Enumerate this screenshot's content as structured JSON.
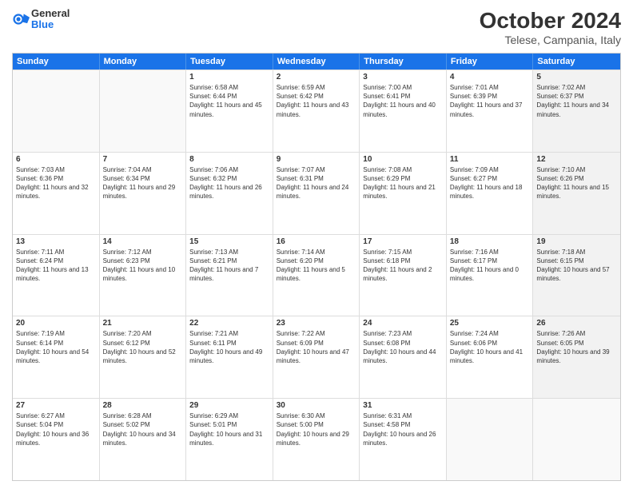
{
  "logo": {
    "line1": "General",
    "line2": "Blue"
  },
  "title": {
    "month": "October 2024",
    "location": "Telese, Campania, Italy"
  },
  "days": [
    "Sunday",
    "Monday",
    "Tuesday",
    "Wednesday",
    "Thursday",
    "Friday",
    "Saturday"
  ],
  "weeks": [
    [
      {
        "day": "",
        "text": "",
        "empty": true
      },
      {
        "day": "",
        "text": "",
        "empty": true
      },
      {
        "day": "1",
        "text": "Sunrise: 6:58 AM\nSunset: 6:44 PM\nDaylight: 11 hours and 45 minutes.",
        "shaded": false
      },
      {
        "day": "2",
        "text": "Sunrise: 6:59 AM\nSunset: 6:42 PM\nDaylight: 11 hours and 43 minutes.",
        "shaded": false
      },
      {
        "day": "3",
        "text": "Sunrise: 7:00 AM\nSunset: 6:41 PM\nDaylight: 11 hours and 40 minutes.",
        "shaded": false
      },
      {
        "day": "4",
        "text": "Sunrise: 7:01 AM\nSunset: 6:39 PM\nDaylight: 11 hours and 37 minutes.",
        "shaded": false
      },
      {
        "day": "5",
        "text": "Sunrise: 7:02 AM\nSunset: 6:37 PM\nDaylight: 11 hours and 34 minutes.",
        "shaded": true
      }
    ],
    [
      {
        "day": "6",
        "text": "Sunrise: 7:03 AM\nSunset: 6:36 PM\nDaylight: 11 hours and 32 minutes.",
        "shaded": false
      },
      {
        "day": "7",
        "text": "Sunrise: 7:04 AM\nSunset: 6:34 PM\nDaylight: 11 hours and 29 minutes.",
        "shaded": false
      },
      {
        "day": "8",
        "text": "Sunrise: 7:06 AM\nSunset: 6:32 PM\nDaylight: 11 hours and 26 minutes.",
        "shaded": false
      },
      {
        "day": "9",
        "text": "Sunrise: 7:07 AM\nSunset: 6:31 PM\nDaylight: 11 hours and 24 minutes.",
        "shaded": false
      },
      {
        "day": "10",
        "text": "Sunrise: 7:08 AM\nSunset: 6:29 PM\nDaylight: 11 hours and 21 minutes.",
        "shaded": false
      },
      {
        "day": "11",
        "text": "Sunrise: 7:09 AM\nSunset: 6:27 PM\nDaylight: 11 hours and 18 minutes.",
        "shaded": false
      },
      {
        "day": "12",
        "text": "Sunrise: 7:10 AM\nSunset: 6:26 PM\nDaylight: 11 hours and 15 minutes.",
        "shaded": true
      }
    ],
    [
      {
        "day": "13",
        "text": "Sunrise: 7:11 AM\nSunset: 6:24 PM\nDaylight: 11 hours and 13 minutes.",
        "shaded": false
      },
      {
        "day": "14",
        "text": "Sunrise: 7:12 AM\nSunset: 6:23 PM\nDaylight: 11 hours and 10 minutes.",
        "shaded": false
      },
      {
        "day": "15",
        "text": "Sunrise: 7:13 AM\nSunset: 6:21 PM\nDaylight: 11 hours and 7 minutes.",
        "shaded": false
      },
      {
        "day": "16",
        "text": "Sunrise: 7:14 AM\nSunset: 6:20 PM\nDaylight: 11 hours and 5 minutes.",
        "shaded": false
      },
      {
        "day": "17",
        "text": "Sunrise: 7:15 AM\nSunset: 6:18 PM\nDaylight: 11 hours and 2 minutes.",
        "shaded": false
      },
      {
        "day": "18",
        "text": "Sunrise: 7:16 AM\nSunset: 6:17 PM\nDaylight: 11 hours and 0 minutes.",
        "shaded": false
      },
      {
        "day": "19",
        "text": "Sunrise: 7:18 AM\nSunset: 6:15 PM\nDaylight: 10 hours and 57 minutes.",
        "shaded": true
      }
    ],
    [
      {
        "day": "20",
        "text": "Sunrise: 7:19 AM\nSunset: 6:14 PM\nDaylight: 10 hours and 54 minutes.",
        "shaded": false
      },
      {
        "day": "21",
        "text": "Sunrise: 7:20 AM\nSunset: 6:12 PM\nDaylight: 10 hours and 52 minutes.",
        "shaded": false
      },
      {
        "day": "22",
        "text": "Sunrise: 7:21 AM\nSunset: 6:11 PM\nDaylight: 10 hours and 49 minutes.",
        "shaded": false
      },
      {
        "day": "23",
        "text": "Sunrise: 7:22 AM\nSunset: 6:09 PM\nDaylight: 10 hours and 47 minutes.",
        "shaded": false
      },
      {
        "day": "24",
        "text": "Sunrise: 7:23 AM\nSunset: 6:08 PM\nDaylight: 10 hours and 44 minutes.",
        "shaded": false
      },
      {
        "day": "25",
        "text": "Sunrise: 7:24 AM\nSunset: 6:06 PM\nDaylight: 10 hours and 41 minutes.",
        "shaded": false
      },
      {
        "day": "26",
        "text": "Sunrise: 7:26 AM\nSunset: 6:05 PM\nDaylight: 10 hours and 39 minutes.",
        "shaded": true
      }
    ],
    [
      {
        "day": "27",
        "text": "Sunrise: 6:27 AM\nSunset: 5:04 PM\nDaylight: 10 hours and 36 minutes.",
        "shaded": false
      },
      {
        "day": "28",
        "text": "Sunrise: 6:28 AM\nSunset: 5:02 PM\nDaylight: 10 hours and 34 minutes.",
        "shaded": false
      },
      {
        "day": "29",
        "text": "Sunrise: 6:29 AM\nSunset: 5:01 PM\nDaylight: 10 hours and 31 minutes.",
        "shaded": false
      },
      {
        "day": "30",
        "text": "Sunrise: 6:30 AM\nSunset: 5:00 PM\nDaylight: 10 hours and 29 minutes.",
        "shaded": false
      },
      {
        "day": "31",
        "text": "Sunrise: 6:31 AM\nSunset: 4:58 PM\nDaylight: 10 hours and 26 minutes.",
        "shaded": false
      },
      {
        "day": "",
        "text": "",
        "empty": true
      },
      {
        "day": "",
        "text": "",
        "empty": true,
        "shaded": true
      }
    ]
  ]
}
